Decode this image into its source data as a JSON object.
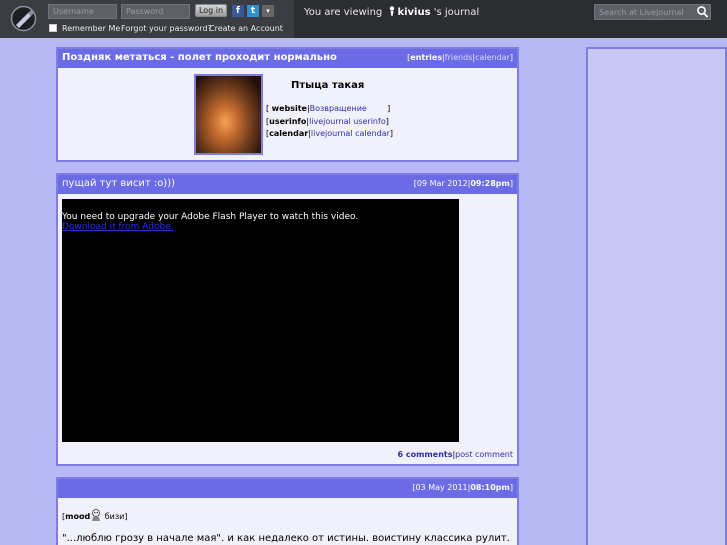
{
  "topbar": {
    "username_placeholder": "Username",
    "password_placeholder": "Password",
    "login_label": "Log in",
    "fb_glyph": "f",
    "tw_glyph": "t",
    "more_glyph": "▾",
    "remember_label": "Remember Me",
    "forgot_label": "Forgot your password?",
    "create_label": "Create an Account",
    "viewing_prefix": "You are viewing",
    "viewing_user": "kivius",
    "viewing_suffix": "'s journal",
    "search_placeholder": "Search at LiveJournal"
  },
  "profile": {
    "title": "Поздняк метаться - полет проходит нормально",
    "nav": {
      "entries": "entries",
      "friends": "friends",
      "calendar": "calendar"
    },
    "journal_name": "Птыца такая",
    "links": {
      "website_key": "website",
      "website_val": "Возвращение",
      "userinfo_key": "userinfo",
      "userinfo_val": "livejournal userinfo",
      "calendar_key": "calendar",
      "calendar_val": "livejournal calendar"
    }
  },
  "entry1": {
    "subject": "пущай тут висит :о)))",
    "date": "09 Mar 2012",
    "time": "09:28pm",
    "flash_msg": "You need to upgrade your Adobe Flash Player to watch this video.",
    "flash_link": "Download it from Adobe.",
    "comments": "6 comments",
    "post_comment": "post comment"
  },
  "entry2": {
    "date": "03 May 2011",
    "time": "08:10pm",
    "mood_key": "mood",
    "mood_val": "бизи",
    "text": "\"...люблю грозу в начале мая\". и как недалеко от истины. воистину классика рулит."
  },
  "colors": {
    "accent": "#6b6be6",
    "page_bg": "#b8b8f4",
    "topbar": "#2b2d31"
  }
}
